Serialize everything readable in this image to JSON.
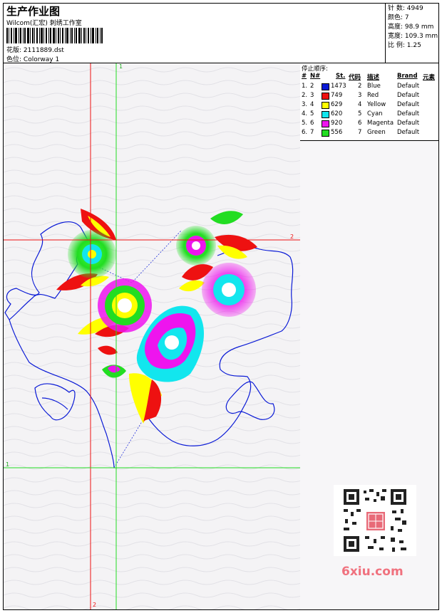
{
  "header": {
    "title": "生产作业图",
    "subtitle": "Wilcom(汇宏) 刺绣工作室",
    "filename_label": "花版:",
    "filename": "2111889.dst",
    "colorway_label": "色位:",
    "colorway": "Colorway 1"
  },
  "stats": {
    "stitches_label": "针 数:",
    "stitches": "4949",
    "colors_label": "颜色:",
    "colors": "7",
    "height_label": "高度:",
    "height": "98.9 mm",
    "width_label": "宽度:",
    "width": "109.3 mm",
    "ratio_label": "比 例:",
    "ratio": "1.25"
  },
  "stop_list": {
    "title": "停止顺序:",
    "headers": {
      "hash": "#",
      "n": "N#",
      "st": "St.",
      "code": "代码",
      "desc": "描述",
      "brand": "Brand",
      "elem": "元素"
    },
    "rows": [
      {
        "idx": "1.",
        "n": "2",
        "color": "#0a1ad6",
        "st": "1473",
        "code": "2",
        "desc": "Blue",
        "brand": "Default"
      },
      {
        "idx": "2.",
        "n": "3",
        "color": "#ee1111",
        "st": "749",
        "code": "3",
        "desc": "Red",
        "brand": "Default"
      },
      {
        "idx": "3.",
        "n": "4",
        "color": "#ffff00",
        "st": "629",
        "code": "4",
        "desc": "Yellow",
        "brand": "Default"
      },
      {
        "idx": "4.",
        "n": "5",
        "color": "#12e6ee",
        "st": "620",
        "code": "5",
        "desc": "Cyan",
        "brand": "Default"
      },
      {
        "idx": "5.",
        "n": "6",
        "color": "#ee14ee",
        "st": "920",
        "code": "6",
        "desc": "Magenta",
        "brand": "Default"
      },
      {
        "idx": "6.",
        "n": "7",
        "color": "#22dd22",
        "st": "556",
        "code": "7",
        "desc": "Green",
        "brand": "Default"
      }
    ]
  },
  "guides": {
    "green_v_label": "1",
    "red_h_label": "2",
    "green_h_label": "1",
    "red_v_label": "2"
  },
  "watermark": {
    "text": "6xiu.com"
  }
}
